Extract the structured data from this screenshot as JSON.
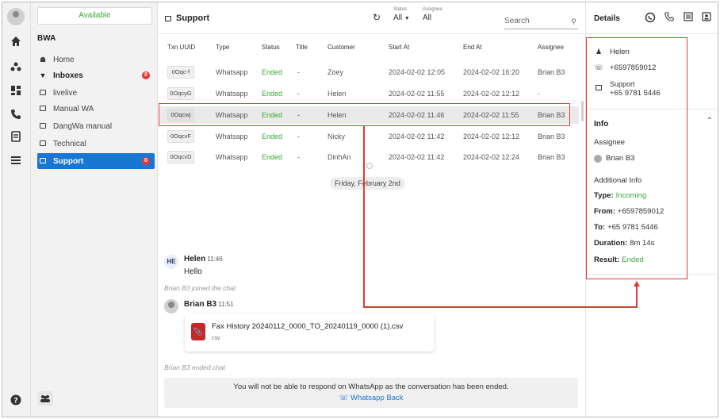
{
  "rail": {
    "icons": [
      "logo-icon",
      "home-icon",
      "users-icon",
      "dashboard-icon",
      "phone-icon",
      "contacts-icon",
      "list-icon",
      "help-icon"
    ]
  },
  "sidebar": {
    "availability": "Available",
    "org_name": "BWA",
    "home_label": "Home",
    "inboxes_label": "Inboxes",
    "inboxes_badge": "0",
    "items": [
      {
        "label": "livelive"
      },
      {
        "label": "Manual WA"
      },
      {
        "label": "DangWa manual"
      },
      {
        "label": "Technical"
      },
      {
        "label": "Support",
        "badge": "0"
      }
    ]
  },
  "topbar": {
    "title": "Support",
    "status_label": "Status",
    "status_value": "All",
    "assignee_label": "Assignee",
    "assignee_value": "All",
    "search_placeholder": "Search"
  },
  "table": {
    "columns": [
      "Txn UUID",
      "Type",
      "Status",
      "Title",
      "Customer",
      "Start At",
      "End At",
      "Assignee"
    ],
    "rows": [
      {
        "uuid": "0Oqc-f",
        "type": "Whatsapp",
        "status": "Ended",
        "title": "-",
        "customer": "Zoey",
        "start": "2024-02-02 12:05",
        "end": "2024-02-02 16:20",
        "assignee": "Brian B3"
      },
      {
        "uuid": "0OqcyG",
        "type": "Whatsapp",
        "status": "Ended",
        "title": "-",
        "customer": "Helen",
        "start": "2024-02-02 11:55",
        "end": "2024-02-02 12:12",
        "assignee": "-"
      },
      {
        "uuid": "0Oqcwj",
        "type": "Whatsapp",
        "status": "Ended",
        "title": "-",
        "customer": "Helen",
        "start": "2024-02-02 11:46",
        "end": "2024-02-02 11:55",
        "assignee": "Brian B3"
      },
      {
        "uuid": "0OqcvF",
        "type": "Whatsapp",
        "status": "Ended",
        "title": "-",
        "customer": "Nicky",
        "start": "2024-02-02 11:42",
        "end": "2024-02-02 12:12",
        "assignee": "Brian B3"
      },
      {
        "uuid": "0OqcvD",
        "type": "Whatsapp",
        "status": "Ended",
        "title": "-",
        "customer": "DinhAn",
        "start": "2024-02-02 11:42",
        "end": "2024-02-02 12:24",
        "assignee": "Brian B3"
      }
    ]
  },
  "chat": {
    "date_divider": "Friday, February 2nd",
    "helen_initials": "HE",
    "helen_name": "Helen",
    "helen_time": "11:46",
    "helen_text": "Hello",
    "join_notice": "Brian B3 joined the chat",
    "brian_name": "Brian B3",
    "brian_time": "11:51",
    "file_name": "Fax History 20240112_0000_TO_20240119_0000 (1).csv",
    "file_ext": "csv",
    "end_notice": "Brian B3 ended chat",
    "ended_message": "You will not be able to respond on WhatsApp as the conversation has been ended.",
    "whatsapp_back": "Whatsapp Back"
  },
  "details": {
    "title": "Details",
    "contact_name": "Helen",
    "contact_phone": "+6597859012",
    "inbox_name": "Support",
    "inbox_phone": "+65 9781 5446",
    "info_title": "Info",
    "assignee_heading": "Assignee",
    "assignee_name": "Brian B3",
    "additional_heading": "Additional Info",
    "type_label": "Type:",
    "type_value": "Incoming",
    "from_label": "From:",
    "from_value": "+6597859012",
    "to_label": "To:",
    "to_value": "+65 9781 5446",
    "duration_label": "Duration:",
    "duration_value": "8m 14s",
    "result_label": "Result:",
    "result_value": "Ended"
  },
  "colors": {
    "accent": "#1976d2",
    "success": "#3aaa35",
    "annotation": "#e53935"
  }
}
